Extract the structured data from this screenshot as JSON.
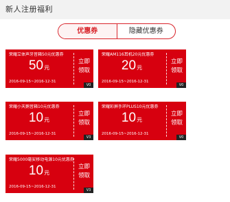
{
  "header": {
    "title": "新人注册福利"
  },
  "tabs": [
    {
      "label": "优惠券"
    },
    {
      "label": "隐藏优惠券"
    }
  ],
  "coupons": [
    {
      "name": "荣耀立体声牙音箱50元优惠券",
      "amount": "50",
      "unit": "元",
      "date": "2016-09-15~2016-12-31",
      "action_1": "立即",
      "action_2": "领取",
      "version": "V0"
    },
    {
      "name": "荣耀AM116耳机20元优惠券",
      "amount": "20",
      "unit": "元",
      "date": "2016-09-15~2016-12-31",
      "action_1": "立即",
      "action_2": "领取",
      "version": "V0"
    },
    {
      "name": "荣耀小天鹅音箱10元优惠券",
      "amount": "10",
      "unit": "元",
      "date": "2016-09-15~2016-12-31",
      "action_1": "立即",
      "action_2": "领取",
      "version": "V3"
    },
    {
      "name": "荣耀彩屏手环PLUS10元优惠券",
      "amount": "10",
      "unit": "元",
      "date": "2016-09-15~2016-12-31",
      "action_1": "立即",
      "action_2": "领取",
      "version": "V0"
    },
    {
      "name": "荣耀5000毫安移动电源10元优惠券",
      "amount": "10",
      "unit": "元",
      "date": "2016-09-15~2016-12-31",
      "action_1": "立即",
      "action_2": "领取",
      "version": "V3"
    }
  ],
  "colors": {
    "accent": "#d7000f",
    "tab_border": "#d8232a",
    "header_bg": "#f2f2f2"
  }
}
